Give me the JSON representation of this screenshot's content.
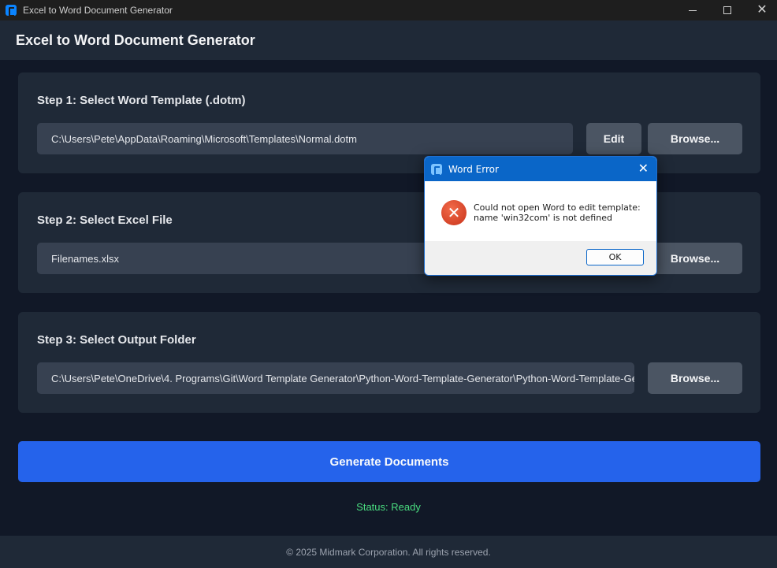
{
  "window": {
    "title": "Excel to Word Document Generator",
    "icon": "app-icon",
    "controls": {
      "minimize": "minimize-icon",
      "maximize": "maximize-icon",
      "close": "✕"
    }
  },
  "header": {
    "title": "Excel to Word Document Generator"
  },
  "steps": [
    {
      "title": "Step 1: Select Word Template (.dotm)",
      "path": "C:\\Users\\Pete\\AppData\\Roaming\\Microsoft\\Templates\\Normal.dotm",
      "edit_label": "Edit",
      "browse_label": "Browse..."
    },
    {
      "title": "Step 2: Select Excel File",
      "path": "Filenames.xlsx",
      "browse_label": "Browse..."
    },
    {
      "title": "Step 3: Select Output Folder",
      "path": "C:\\Users\\Pete\\OneDrive\\4. Programs\\Git\\Word Template Generator\\Python-Word-Template-Generator\\Python-Word-Template-Ge",
      "browse_label": "Browse..."
    }
  ],
  "generate_label": "Generate Documents",
  "status": "Status: Ready",
  "footer": "© 2025 Midmark Corporation. All rights reserved.",
  "dialog": {
    "title": "Word Error",
    "close": "✕",
    "icon": "error-icon",
    "icon_glyph": "✕",
    "message": "Could not open Word to edit template: name 'win32com' is not defined",
    "ok_label": "OK"
  },
  "colors": {
    "background": "#111827",
    "panel": "#1f2937",
    "field": "#374151",
    "button": "#4b5563",
    "primary": "#2563eb",
    "status": "#4ade80",
    "dialog_titlebar": "#0a66c8",
    "error_icon": "#d9411f"
  }
}
